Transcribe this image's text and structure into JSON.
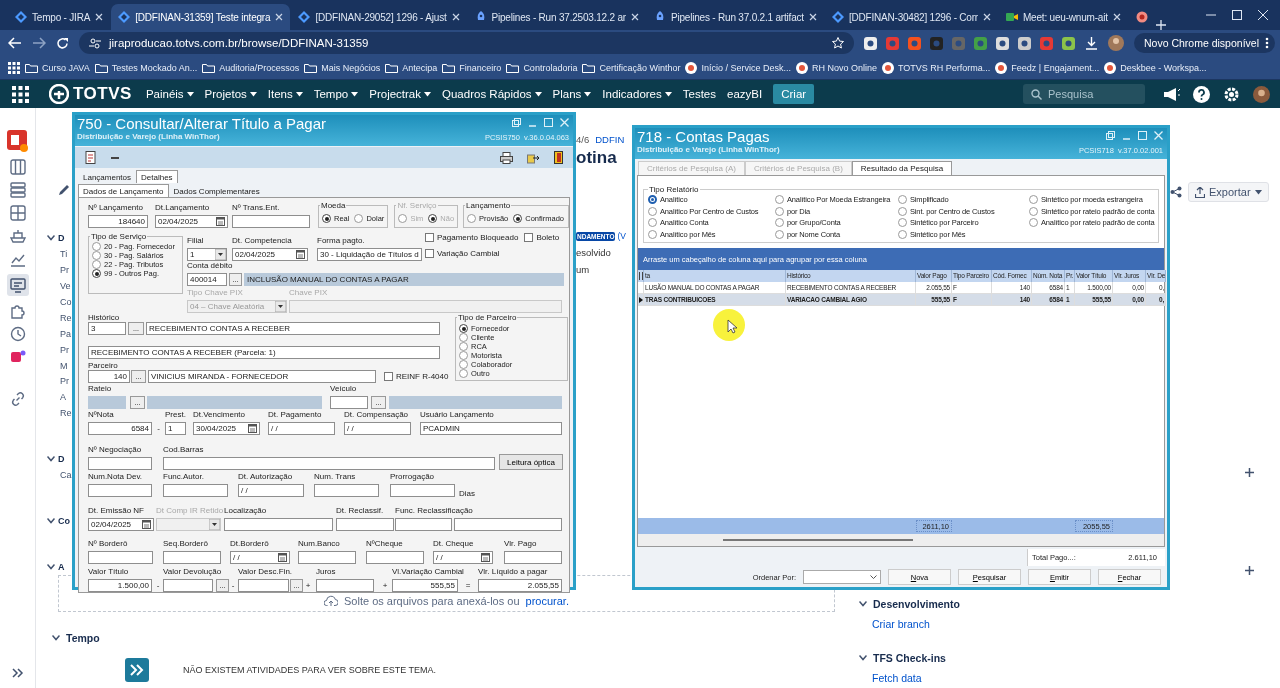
{
  "browser": {
    "tabs": [
      {
        "title": "Tempo - JIRA",
        "kind": "jira",
        "selected": false
      },
      {
        "title": "[DDFINAN-31359] Teste integra",
        "kind": "jira",
        "selected": true
      },
      {
        "title": "[DDFINAN-29052] 1296 - Ajust",
        "kind": "jira",
        "selected": false
      },
      {
        "title": "Pipelines - Run 37.2503.12.2 ar",
        "kind": "pipeline",
        "selected": false
      },
      {
        "title": "Pipelines - Run 37.0.2.1 artifact",
        "kind": "pipeline",
        "selected": false
      },
      {
        "title": "[DDFINAN-30482] 1296 - Corr",
        "kind": "jira",
        "selected": false
      },
      {
        "title": "Meet: ueu-wnum-ait",
        "kind": "meet",
        "selected": false
      }
    ],
    "url": "jiraproducao.totvs.com.br/browse/DDFINAN-31359",
    "update_button": "Novo Chrome disponível",
    "bookmarks": [
      {
        "label": "Curso JAVA",
        "kind": "folder"
      },
      {
        "label": "Testes Mockado An...",
        "kind": "folder"
      },
      {
        "label": "Auditoria/Processos",
        "kind": "folder"
      },
      {
        "label": "Mais Negócios",
        "kind": "folder"
      },
      {
        "label": "Antecipa",
        "kind": "folder"
      },
      {
        "label": "Financeiro",
        "kind": "folder"
      },
      {
        "label": "Controladoria",
        "kind": "folder"
      },
      {
        "label": "Certificação Winthor",
        "kind": "folder"
      },
      {
        "label": "Início / Service Desk...",
        "kind": "site"
      },
      {
        "label": "RH Novo Online",
        "kind": "site"
      },
      {
        "label": "TOTVS RH Performa...",
        "kind": "site"
      },
      {
        "label": "Feedz | Engajament...",
        "kind": "site"
      },
      {
        "label": "Deskbee - Workspa...",
        "kind": "site"
      }
    ]
  },
  "jira_nav": {
    "logo": "TOTVS",
    "menu": [
      {
        "label": "Painéis",
        "dropdown": true
      },
      {
        "label": "Projetos",
        "dropdown": true
      },
      {
        "label": "Itens",
        "dropdown": true
      },
      {
        "label": "Tempo",
        "dropdown": true
      },
      {
        "label": "Projectrak",
        "dropdown": true
      },
      {
        "label": "Quadros Rápidos",
        "dropdown": true
      },
      {
        "label": "Plans",
        "dropdown": true
      },
      {
        "label": "Indicadores",
        "dropdown": true
      },
      {
        "label": "Testes",
        "dropdown": false
      },
      {
        "label": "eazyBI",
        "dropdown": false
      }
    ],
    "create_button": "Criar",
    "search_placeholder": "Pesquisa"
  },
  "issue_page": {
    "breadcrumb_fragment": "4/6",
    "breadcrumb_link": "DDFIN",
    "title_fragment": "otina",
    "status_badge": "NDAMENTO",
    "status_link": "(V",
    "resolution_fragment": "esolvido",
    "fragment": "um",
    "export_button": "Exportar",
    "left_fragments": [
      {
        "text": "D",
        "kind": "header"
      },
      {
        "text": "Ti",
        "kind": "label"
      },
      {
        "text": "Pr",
        "kind": "label"
      },
      {
        "text": "Ve",
        "kind": "label"
      },
      {
        "text": "Co",
        "kind": "label"
      },
      {
        "text": "Re",
        "kind": "label"
      },
      {
        "text": "Pa",
        "kind": "label"
      },
      {
        "text": "Pr",
        "kind": "label"
      },
      {
        "text": "M",
        "kind": "label"
      },
      {
        "text": "Pr",
        "kind": "label"
      },
      {
        "text": "A",
        "kind": "label"
      },
      {
        "text": "Re",
        "kind": "label"
      },
      {
        "text": "D",
        "kind": "header"
      },
      {
        "text": "Ca",
        "kind": "label"
      },
      {
        "text": "Co",
        "kind": "header"
      },
      {
        "text": "A",
        "kind": "header"
      }
    ],
    "drop_zone": {
      "text": "Solte os arquivos para anexá-los ou",
      "link": "procurar."
    },
    "tempo": {
      "title": "Tempo",
      "empty_message": "NÃO EXISTEM ATIVIDADES PARA VER SOBRE ESTE TEMA."
    },
    "development": {
      "title": "Desenvolvimento",
      "link": "Criar branch"
    },
    "tfs": {
      "title": "TFS Check-ins",
      "link": "Fetch data"
    }
  },
  "window_750": {
    "title": "750 - Consultar/Alterar Título a Pagar",
    "subtitle": "Distribuição e Varejo (Linha WinThor)",
    "version": "PCSIS750  v.36.0.04.063",
    "tabs": [
      {
        "label": "Lançamentos",
        "selected": false
      },
      {
        "label": "Detalhes",
        "selected": true
      }
    ],
    "subtabs": [
      {
        "label": "Dados de Lançamento",
        "selected": true
      },
      {
        "label": "Dados Complementares",
        "selected": false
      }
    ],
    "form": {
      "row1": [
        {
          "label": "Nº Lançamento",
          "value": "184640",
          "kind": "number"
        },
        {
          "label": "Dt.Lançamento",
          "value": "02/04/2025",
          "kind": "date"
        },
        {
          "label": "Nº Trans.Ent.",
          "kind": "text"
        },
        {
          "label": "Moeda",
          "kind": "group",
          "disabled": false,
          "options": [
            {
              "label": "Real",
              "selected": true
            },
            {
              "label": "Dolar",
              "selected": false
            }
          ]
        },
        {
          "label": "Nf. Serviço",
          "kind": "group",
          "disabled": true,
          "options": [
            {
              "label": "Sim",
              "selected": false
            },
            {
              "label": "Não",
              "selected": true
            }
          ]
        },
        {
          "label": "Lançamento",
          "kind": "group",
          "disabled": false,
          "options": [
            {
              "label": "Provisão",
              "selected": false
            },
            {
              "label": "Confirmado",
              "selected": true
            }
          ]
        }
      ],
      "tipo_servico": {
        "label": "Tipo de Serviço",
        "options": [
          {
            "label": "20 - Pag. Fornecedor",
            "selected": false
          },
          {
            "label": "30 - Pag. Salários",
            "selected": false
          },
          {
            "label": "22 - Pag. Tributos",
            "selected": false
          },
          {
            "label": "99 - Outros Pag.",
            "selected": true
          }
        ]
      },
      "row2": [
        {
          "label": "Filial",
          "value": "1",
          "kind": "combo"
        },
        {
          "label": "Dt. Competencia",
          "value": "02/04/2025",
          "kind": "date"
        },
        {
          "label": "Forma pagto.",
          "value": "30 - Liquidação de Títulos d",
          "kind": "combo"
        }
      ],
      "flags": [
        {
          "label": "Pagamento Bloqueado",
          "checked": false
        },
        {
          "label": "Boleto",
          "checked": false
        },
        {
          "label": "Variação Cambial",
          "checked": false
        }
      ],
      "row3": [
        {
          "label": "Conta débito",
          "value": "400014",
          "kind": "text"
        },
        {
          "label": "...",
          "kind": "ellipsis"
        },
        {
          "value": "INCLUSÃO MANUAL DO CONTAS A PAGAR",
          "kind": "readonly"
        }
      ],
      "row4": [
        {
          "label": "Tipo Chave PIX",
          "value": "04 – Chave Aleatória",
          "kind": "combo",
          "disabled": true
        },
        {
          "label": "Chave PIX",
          "kind": "text",
          "disabled": true
        }
      ],
      "historico": [
        {
          "label": "Histórico",
          "value": "3",
          "kind": "text"
        },
        {
          "label": "...",
          "kind": "ellipsis"
        },
        {
          "value": "RECEBIMENTO CONTAS A RECEBER",
          "kind": "text"
        }
      ],
      "historico_2": [
        {
          "value": "RECEBIMENTO CONTAS A RECEBER (Parcela: 1)",
          "kind": "text"
        }
      ],
      "parceiro": [
        {
          "label": "Parceiro",
          "value": "140",
          "kind": "number"
        },
        {
          "label": "...",
          "kind": "ellipsis"
        },
        {
          "value": "VINICIUS MIRANDA - FORNECEDOR",
          "kind": "text"
        },
        {
          "label": "REINF R-4040",
          "kind": "check",
          "checked": false
        }
      ],
      "tipo_parceiro": {
        "label": "Tipo de Parceiro",
        "options": [
          {
            "label": "Fornecedor",
            "selected": true
          },
          {
            "label": "Cliente",
            "selected": false
          },
          {
            "label": "RCA",
            "selected": false
          },
          {
            "label": "Motorista",
            "selected": false
          },
          {
            "label": "Colaborador",
            "selected": false
          },
          {
            "label": "Outro",
            "selected": false
          }
        ]
      },
      "lines": [
        [
          {
            "label": "Rateio",
            "kind": "readonly"
          },
          {
            "label": "...",
            "kind": "ellipsis"
          },
          {
            "kind": "readonly"
          },
          {
            "label": "Veículo",
            "kind": "text"
          },
          {
            "label": "...",
            "kind": "ellipsis"
          },
          {
            "kind": "readonly"
          }
        ],
        [
          {
            "label": "NºNota",
            "value": "6584",
            "kind": "number"
          },
          {
            "label": "-",
            "kind": "operator"
          },
          {
            "label": "Prest.",
            "value": "1",
            "kind": "text"
          },
          {
            "label": "Dt.Vencimento",
            "value": "30/04/2025",
            "kind": "date"
          },
          {
            "label": "Dt. Pagamento",
            "value": "/ /",
            "kind": "text"
          },
          {
            "label": "Dt. Compensação",
            "value": "/ /",
            "kind": "text"
          },
          {
            "label": "Usuário Lançamento",
            "value": "PCADMIN",
            "kind": "text"
          }
        ],
        [
          {
            "label": "Nº Negociação",
            "kind": "text"
          },
          {
            "label": "Cod.Barras",
            "kind": "text"
          },
          {
            "label": "Leitura óptica",
            "kind": "button"
          }
        ],
        [
          {
            "label": "Num.Nota Dev.",
            "kind": "text"
          },
          {
            "label": "Func.Autor.",
            "kind": "text"
          },
          {
            "label": "Dt. Autorização",
            "value": "/ /",
            "kind": "text"
          },
          {
            "label": "Num. Trans",
            "kind": "text"
          },
          {
            "label": "Prorrogação",
            "kind": "text"
          },
          {
            "label": "Dias",
            "kind": "note"
          }
        ],
        [
          {
            "label": "Dt. Emissão NF",
            "value": "02/04/2025",
            "kind": "date",
            "disabled": false
          },
          {
            "label": "Dt Comp IR Retido",
            "kind": "combo",
            "disabled": true
          },
          {
            "label": "Localização",
            "kind": "text",
            "disabled": false
          },
          {
            "label": "Dt. Reclassif.",
            "kind": "text",
            "disabled": false
          },
          {
            "label": "Func. Reclassificação",
            "kind": "text",
            "disabled": false
          },
          {
            "kind": "text",
            "disabled": false
          }
        ],
        [
          {
            "label": "Nº Borderô",
            "kind": "text"
          },
          {
            "label": "Seq.Borderô",
            "kind": "text"
          },
          {
            "label": "Dt.Borderô",
            "value": "/ /",
            "kind": "date"
          },
          {
            "label": "Num.Banco",
            "kind": "text"
          },
          {
            "label": "NºCheque",
            "kind": "text"
          },
          {
            "label": "Dt. Cheque",
            "value": "/ /",
            "kind": "date"
          },
          {
            "label": "Vlr. Pago",
            "kind": "text"
          }
        ],
        [
          {
            "label": "Valor Título",
            "value": "1.500,00",
            "kind": "number"
          },
          {
            "label": "-",
            "kind": "operator"
          },
          {
            "label": "Valor Devolução",
            "kind": "text"
          },
          {
            "label": "...",
            "kind": "ellipsis"
          },
          {
            "label": "-",
            "kind": "operator"
          },
          {
            "label": "Valor Desc.Fin.",
            "kind": "text"
          },
          {
            "label": "...",
            "kind": "ellipsis"
          },
          {
            "label": "+",
            "kind": "operator"
          },
          {
            "label": "Juros",
            "kind": "text"
          },
          {
            "label": "+",
            "kind": "operator"
          },
          {
            "label": "Vl.Variação Cambial",
            "value": "555,55",
            "kind": "number"
          },
          {
            "label": "=",
            "kind": "operator"
          },
          {
            "label": "Vlr. Líquido a pagar",
            "value": "2.055,55",
            "kind": "number"
          }
        ]
      ]
    }
  },
  "window_718": {
    "title": "718 - Contas Pagas",
    "subtitle": "Distribuição e Varejo (Linha WinThor)",
    "version": "PCSIS718  v.37.0.02.001",
    "tabs": [
      {
        "label": "Critérios de Pesquisa (A)",
        "selected": false
      },
      {
        "label": "Critérios de Pesquisa (B)",
        "selected": false
      },
      {
        "label": "Resultado da Pesquisa",
        "selected": true
      }
    ],
    "report_type": {
      "label": "Tipo Relatório",
      "options": [
        {
          "label": "Analítico",
          "selected": true
        },
        {
          "label": "Analítico Por Centro de Custos",
          "selected": false
        },
        {
          "label": "Analítico Conta",
          "selected": false
        },
        {
          "label": "Analítico por Mês",
          "selected": false
        },
        {
          "label": "Analítico Por Moeda Estrangeira",
          "selected": false
        },
        {
          "label": "por Dia",
          "selected": false
        },
        {
          "label": "por Grupo/Conta",
          "selected": false
        },
        {
          "label": "por Nome Conta",
          "selected": false
        },
        {
          "label": "Simplificado",
          "selected": false
        },
        {
          "label": "Sint. por Centro de Custos",
          "selected": false
        },
        {
          "label": "Sintético por Parceiro",
          "selected": false
        },
        {
          "label": "Sintético por Mês",
          "selected": false
        },
        {
          "label": "Sintético por moeda estrangeira",
          "selected": false
        },
        {
          "label": "Sintético por rateio padrão de conta",
          "selected": false
        },
        {
          "label": "Analítico por rateio padrão de conta",
          "selected": false
        }
      ]
    },
    "group_hint": "Arraste um cabeçalho de coluna aqui para agrupar por essa coluna",
    "table": {
      "columns": [
        "ta",
        "Histórico",
        "Valor Pago",
        "Tipo Parceiro",
        "Cód. Fornec",
        "Núm. Nota",
        "Pr.",
        "Valor Título",
        "Vlr. Juros",
        "Vlr. De"
      ],
      "rows": [
        {
          "cells": [
            "LUSÃO MANUAL DO CONTAS A PAGAR",
            "RECEBIMENTO CONTAS A RECEBER",
            "2.055,55",
            "F",
            "140",
            "6584",
            "1",
            "1.500,00",
            "0,00",
            "0,"
          ],
          "selected": false
        },
        {
          "cells": [
            "TRAS CONTRIBUICOES",
            "VARIACAO CAMBIAL AGIO",
            "555,55",
            "F",
            "140",
            "6584",
            "1",
            "555,55",
            "0,00",
            "0,"
          ],
          "selected": true
        }
      ],
      "totals": {
        "valor_pago": "2611,10",
        "valor_titulo": "2055,55"
      }
    },
    "total_label": "Total Pago...:",
    "total_value": "2.611,10",
    "order_label": "Ordenar Por:",
    "buttons": [
      "Nova",
      "Pesquisar",
      "Emitir",
      "Fechar"
    ]
  }
}
